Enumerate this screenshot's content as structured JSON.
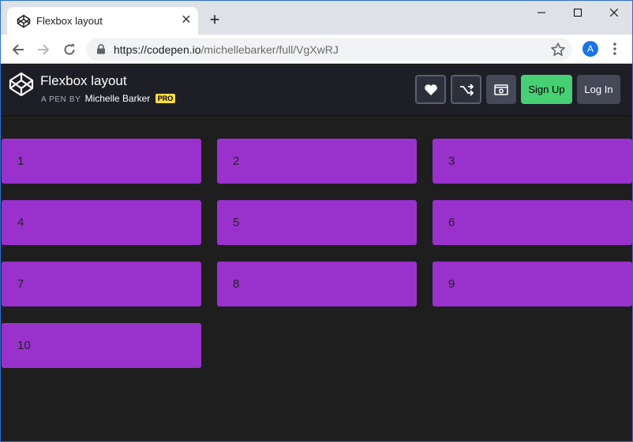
{
  "browser": {
    "tab_title": "Flexbox layout",
    "close_glyph": "✕",
    "new_tab_glyph": "+",
    "url_host": "https://codepen.io",
    "url_path": "/michellebarker/full/VgXwRJ",
    "profile_initial": "A"
  },
  "codepen": {
    "title": "Flexbox layout",
    "byline_prefix": "A PEN BY",
    "author": "Michelle Barker",
    "pro_badge": "PRO",
    "signup_label": "Sign Up",
    "login_label": "Log In"
  },
  "grid": {
    "items": [
      "1",
      "2",
      "3",
      "4",
      "5",
      "6",
      "7",
      "8",
      "9",
      "10"
    ],
    "item_color": "#9932cc"
  },
  "colors": {
    "header_bg": "#1e1f26",
    "page_bg": "#1e1e1e",
    "signup_green": "#47cf73"
  },
  "icons": [
    "codepen-logo-icon",
    "close-icon",
    "plus-icon",
    "minimize-icon",
    "maximize-icon",
    "window-close-icon",
    "back-arrow-icon",
    "forward-arrow-icon",
    "reload-icon",
    "lock-icon",
    "star-icon",
    "menu-icon",
    "heart-icon",
    "fork-icon",
    "eye-icon"
  ]
}
